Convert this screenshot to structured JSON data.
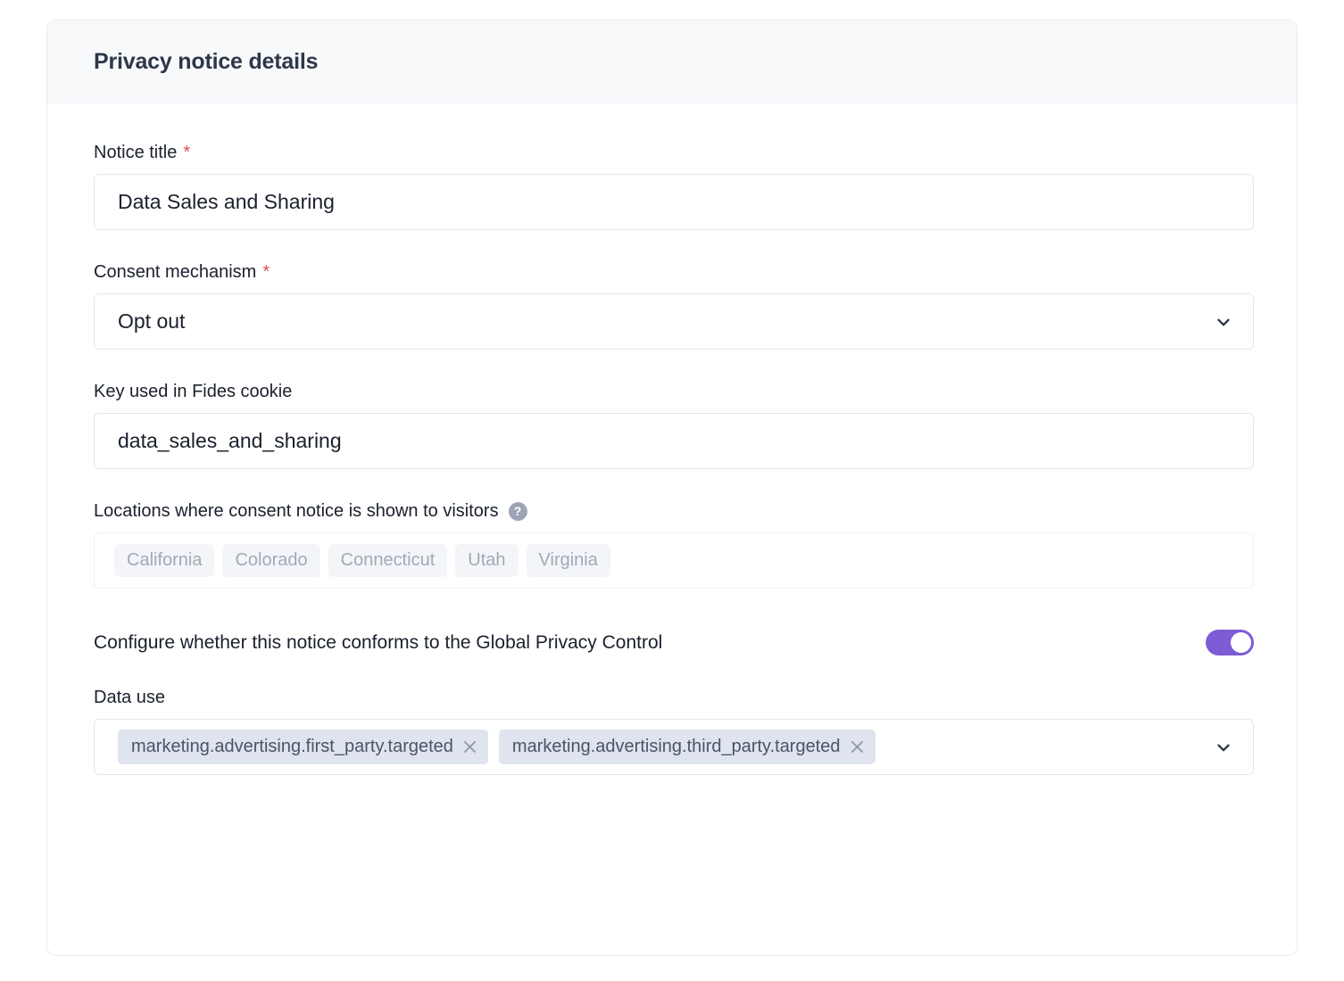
{
  "card": {
    "title": "Privacy notice details"
  },
  "fields": {
    "notice_title": {
      "label": "Notice title",
      "required_marker": "*",
      "value": "Data Sales and Sharing"
    },
    "consent_mechanism": {
      "label": "Consent mechanism",
      "required_marker": "*",
      "value": "Opt out",
      "chevron_icon": "chevron-down-icon"
    },
    "fides_key": {
      "label": "Key used in Fides cookie",
      "value": "data_sales_and_sharing"
    },
    "locations": {
      "label": "Locations where consent notice is shown to visitors",
      "help_icon": "help-circle-icon",
      "help_glyph": "?",
      "tags": [
        "California",
        "Colorado",
        "Connecticut",
        "Utah",
        "Virginia"
      ]
    },
    "gpc": {
      "label": "Configure whether this notice conforms to the Global Privacy Control",
      "toggle_state": "on"
    },
    "data_use": {
      "label": "Data use",
      "chevron_icon": "chevron-down-icon",
      "tags": [
        {
          "label": "marketing.advertising.first_party.targeted",
          "remove_icon": "close-icon"
        },
        {
          "label": "marketing.advertising.third_party.targeted",
          "remove_icon": "close-icon"
        }
      ]
    }
  },
  "colors": {
    "accent_toggle": "#7d5cd6",
    "required_asterisk": "#e05252",
    "header_bg": "#f8f9fb",
    "tag_bg": "#dfe4ee",
    "disabled_tag_text": "#a0aab8",
    "help_icon_bg": "#9aa5b5",
    "border": "#e2e8f0"
  }
}
